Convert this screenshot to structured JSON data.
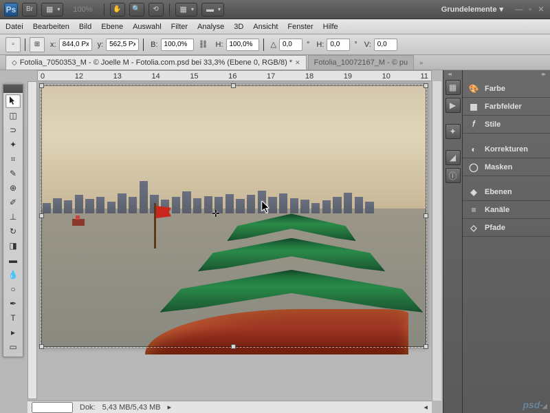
{
  "appbar": {
    "zoom": "100%",
    "workspace": "Grundelemente"
  },
  "menu": [
    "Datei",
    "Bearbeiten",
    "Bild",
    "Ebene",
    "Auswahl",
    "Filter",
    "Analyse",
    "3D",
    "Ansicht",
    "Fenster",
    "Hilfe"
  ],
  "options": {
    "x_label": "x:",
    "x": "844,0 Px",
    "y_label": "y:",
    "y": "562,5 Px",
    "w_label": "B:",
    "w": "100,0%",
    "h_label": "H:",
    "h": "100,0%",
    "a_label": "△",
    "a": "0,0",
    "sh_label": "H:",
    "sh": "0,0",
    "sv_label": "V:",
    "sv": "0,0"
  },
  "tabs": [
    {
      "label": "Fotolia_7050353_M - © Joelle M - Fotolia.com.psd bei 33,3% (Ebene 0, RGB/8) *",
      "active": true
    },
    {
      "label": "Fotolia_10072167_M - © pu",
      "active": false
    }
  ],
  "ruler": [
    "0",
    "12",
    "13",
    "14",
    "15",
    "16",
    "17",
    "18",
    "19",
    "10",
    "11"
  ],
  "status": {
    "zoom": "",
    "dok_label": "Dok:",
    "dok": "5,43 MB/5,43 MB"
  },
  "panel_left": [
    "palette",
    "play",
    "wheel",
    "image",
    "info"
  ],
  "panel_right": [
    {
      "icon": "🎨",
      "label": "Farbe"
    },
    {
      "icon": "▦",
      "label": "Farbfelder"
    },
    {
      "icon": "𝑓",
      "label": "Stile"
    },
    {
      "gap": true
    },
    {
      "icon": "◐",
      "label": "Korrekturen"
    },
    {
      "icon": "◯",
      "label": "Masken"
    },
    {
      "gap": true
    },
    {
      "icon": "◈",
      "label": "Ebenen"
    },
    {
      "icon": "≡",
      "label": "Kanäle"
    },
    {
      "icon": "⌘",
      "label": "Pfade"
    }
  ],
  "watermark": "psd-"
}
